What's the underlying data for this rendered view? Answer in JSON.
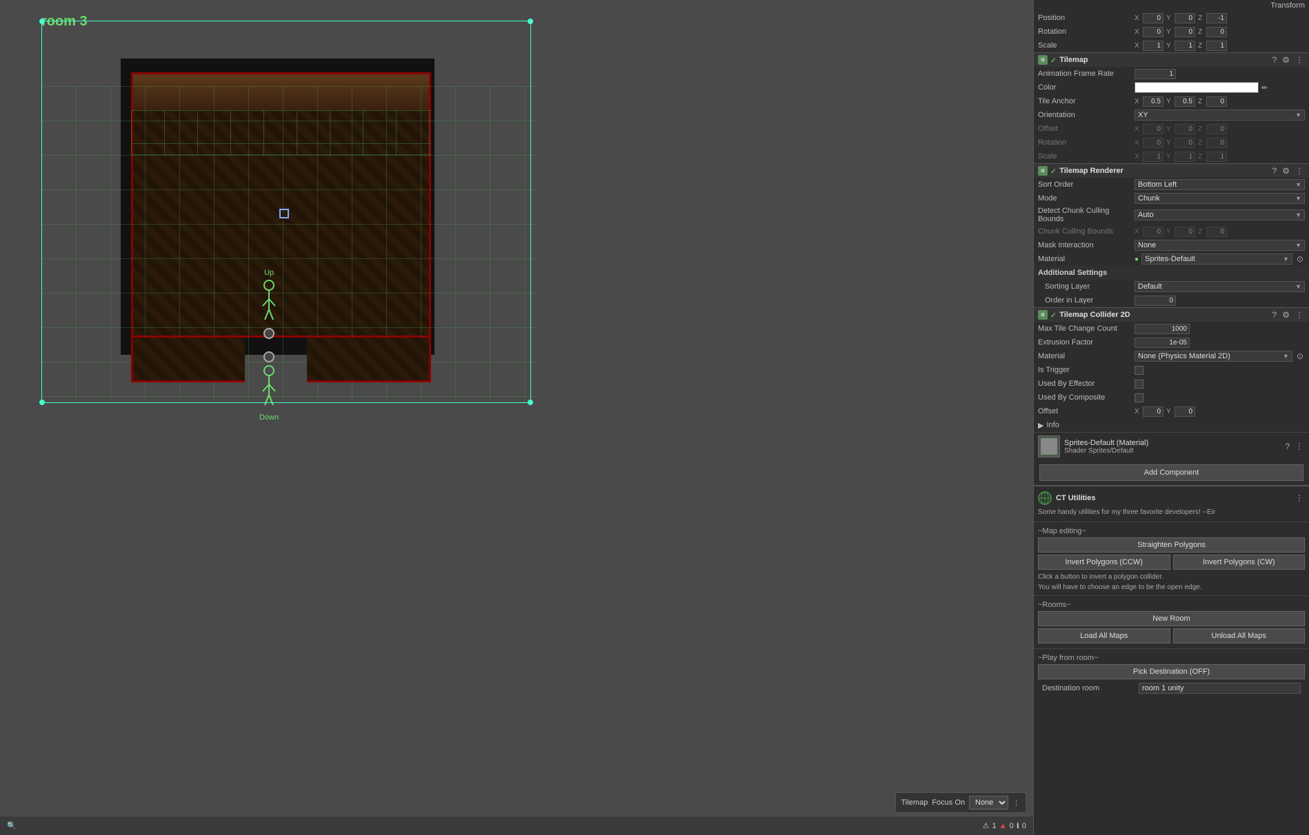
{
  "scene": {
    "room_label": "room 3",
    "tilemap_label": "Tilemap",
    "focus_on_label": "Focus On",
    "focus_on_value": "None"
  },
  "inspector": {
    "transform": {
      "position_label": "Position",
      "position": {
        "x": "0",
        "y": "0",
        "z": "-1"
      },
      "rotation_label": "Rotation",
      "rotation": {
        "x": "0",
        "y": "0",
        "z": "0"
      },
      "scale_label": "Scale",
      "scale": {
        "x": "1",
        "y": "1",
        "z": "1"
      }
    },
    "tilemap": {
      "title": "Tilemap",
      "animation_frame_rate_label": "Animation Frame Rate",
      "animation_frame_rate_value": "1",
      "color_label": "Color",
      "tile_anchor_label": "Tile Anchor",
      "tile_anchor": {
        "x": "0.5",
        "y": "0.5",
        "z": "0"
      },
      "orientation_label": "Orientation",
      "orientation_value": "XY",
      "offset_label": "Offset",
      "offset": {
        "x": "0",
        "y": "0",
        "z": "0"
      },
      "rotation_label": "Rotation",
      "rotation": {
        "x": "0",
        "y": "0",
        "z": "0"
      },
      "scale_label": "Scale",
      "scale": {
        "x": "1",
        "y": "1",
        "z": "1"
      }
    },
    "tilemap_renderer": {
      "title": "Tilemap Renderer",
      "sort_order_label": "Sort Order",
      "sort_order_value": "Bottom Left",
      "mode_label": "Mode",
      "mode_value": "Chunk",
      "detect_chunk_culling_label": "Detect Chunk Culling Bounds",
      "detect_chunk_culling_value": "Auto",
      "chunk_culling_bounds_label": "Chunk Culling Bounds",
      "chunk_culling_bounds": {
        "x": "0",
        "y": "0",
        "z": "0"
      },
      "mask_interaction_label": "Mask Interaction",
      "mask_interaction_value": "None",
      "material_label": "Material",
      "material_value": "Sprites-Default",
      "additional_settings_label": "Additional Settings",
      "sorting_layer_label": "Sorting Layer",
      "sorting_layer_value": "Default",
      "order_in_layer_label": "Order in Layer",
      "order_in_layer_value": "0"
    },
    "tilemap_collider": {
      "title": "Tilemap Collider 2D",
      "max_tile_change_label": "Max Tile Change Count",
      "max_tile_change_value": "1000",
      "extrusion_factor_label": "Extrusion Factor",
      "extrusion_factor_value": "1e-05",
      "material_label": "Material",
      "material_value": "None (Physics Material 2D)",
      "is_trigger_label": "Is Trigger",
      "used_by_effector_label": "Used By Effector",
      "used_by_composite_label": "Used By Composite",
      "offset_label": "Offset",
      "offset": {
        "x": "0",
        "y": "0"
      }
    },
    "info": {
      "label": "Info"
    },
    "material_preview": {
      "name": "Sprites-Default (Material)",
      "shader_label": "Shader",
      "shader_value": "Sprites/Default"
    },
    "add_component": "Add Component",
    "ct_utilities": {
      "title": "CT Utilities",
      "description": "Some handy utilities for my three favorite developers! --Eir",
      "map_editing_label": "~Map editing~",
      "straighten_polygons": "Straighten Polygons",
      "invert_polygons_ccw": "Invert Polygons (CCW)",
      "invert_polygons_cw": "Invert Polygons (CW)",
      "invert_note1": "Click a button to invert a polygon collider.",
      "invert_note2": "You will have to choose an edge to be the open edge.",
      "rooms_label": "~Rooms~",
      "new_room": "New Room",
      "load_all_maps": "Load All Maps",
      "unload_all_maps": "Unload All Maps",
      "play_from_room_label": "~Play from room~",
      "pick_destination": "Pick Destination (OFF)",
      "destination_room_label": "Destination room",
      "destination_room_value": "room 1 unity"
    }
  },
  "status_bar": {
    "warning_count": "1",
    "error_count": "0",
    "info_count": "0"
  }
}
